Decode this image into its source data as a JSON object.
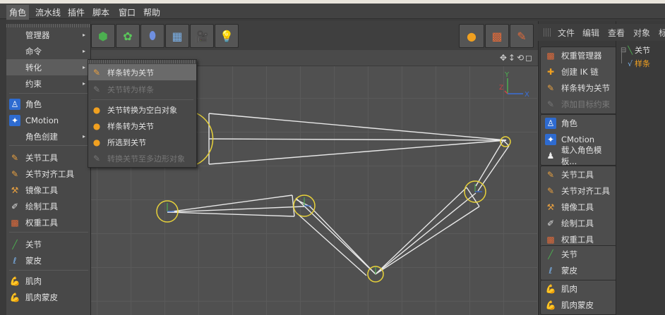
{
  "menubar": {
    "items": [
      "角色",
      "流水线",
      "插件",
      "脚本",
      "窗口",
      "帮助"
    ],
    "active": "角色"
  },
  "char_menu": {
    "items": [
      {
        "label": "管理器",
        "arrow": "▸"
      },
      {
        "label": "命令",
        "arrow": "▸"
      },
      {
        "label": "转化",
        "arrow": "▸"
      },
      {
        "label": "约束",
        "arrow": "▸"
      },
      {
        "label": "角色"
      },
      {
        "label": "CMotion"
      },
      {
        "label": "角色创建",
        "arrow": "▸"
      },
      {
        "label": "关节工具"
      },
      {
        "label": "关节对齐工具"
      },
      {
        "label": "镜像工具"
      },
      {
        "label": "绘制工具"
      },
      {
        "label": "权重工具"
      },
      {
        "label": "关节"
      },
      {
        "label": "蒙皮"
      },
      {
        "label": "肌肉"
      },
      {
        "label": "肌肉蒙皮"
      }
    ]
  },
  "convert_submenu": {
    "items": [
      {
        "label": "样条转为关节",
        "state": "highlighted"
      },
      {
        "label": "关节转为样条",
        "state": "disabled"
      },
      {
        "label": "关节转换为空白对象",
        "state": "normal"
      },
      {
        "label": "样条转为关节",
        "state": "normal"
      },
      {
        "label": "所选到关节",
        "state": "normal"
      },
      {
        "label": "转换关节至多边形对象",
        "state": "disabled"
      }
    ]
  },
  "right_panel": {
    "groups": [
      {
        "items": [
          {
            "label": "权重管理器",
            "icon": "weight-manager-icon"
          },
          {
            "label": "创建 IK 链",
            "icon": "ik-chain-icon"
          },
          {
            "label": "样条转为关节",
            "icon": "spline-to-joint-icon"
          },
          {
            "label": "添加目标约束",
            "icon": "target-constraint-icon",
            "disabled": true
          }
        ]
      },
      {
        "items": [
          {
            "label": "角色",
            "icon": "character-icon"
          },
          {
            "label": "CMotion",
            "icon": "cmotion-icon"
          },
          {
            "label": "载入角色模板...",
            "icon": "load-template-icon"
          }
        ]
      },
      {
        "items": [
          {
            "label": "关节工具",
            "icon": "joint-tool-icon"
          },
          {
            "label": "关节对齐工具",
            "icon": "joint-align-icon"
          },
          {
            "label": "镜像工具",
            "icon": "mirror-tool-icon"
          },
          {
            "label": "绘制工具",
            "icon": "paint-tool-icon"
          },
          {
            "label": "权重工具",
            "icon": "weight-tool-icon"
          }
        ]
      },
      {
        "items": [
          {
            "label": "关节",
            "icon": "joint-icon"
          },
          {
            "label": "蒙皮",
            "icon": "skin-icon"
          }
        ]
      },
      {
        "items": [
          {
            "label": "肌肉",
            "icon": "muscle-icon"
          },
          {
            "label": "肌肉蒙皮",
            "icon": "muscle-skin-icon"
          }
        ]
      }
    ]
  },
  "object_manager": {
    "menu": [
      "文件",
      "编辑",
      "查看",
      "对象",
      "标"
    ],
    "tree": [
      {
        "label": "关节"
      },
      {
        "label": "样条",
        "selected": true
      }
    ]
  },
  "viewport": {
    "axis_x": "X",
    "axis_y": "Y",
    "axis_z": "Z"
  },
  "colors": {
    "joint_ring": "#e8d23a",
    "bone_line": "#e8e8e8",
    "selected_text": "#f0a020",
    "axis_y": "#4caf50",
    "axis_x": "#3b6fd8"
  }
}
